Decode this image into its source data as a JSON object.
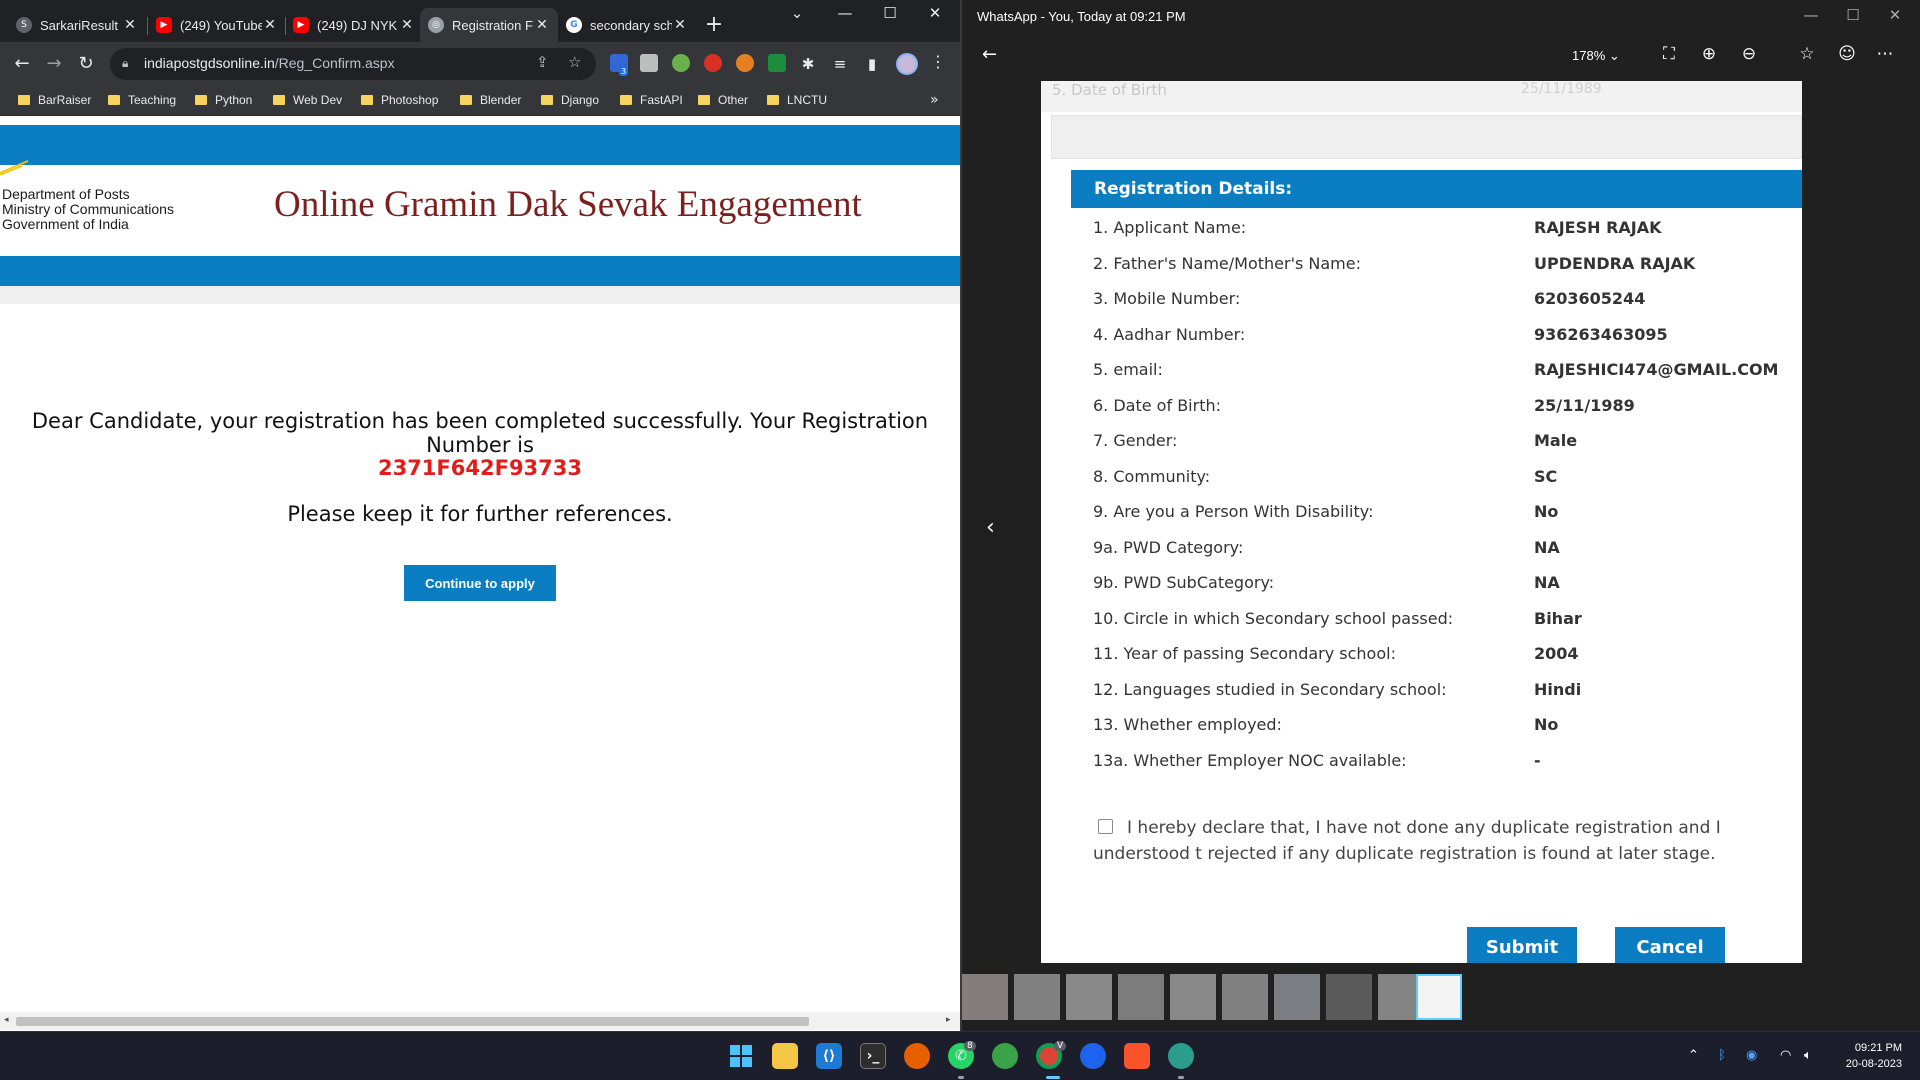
{
  "chrome": {
    "tabs": [
      {
        "title": "SarkariResult",
        "icon": "sarkari-favicon",
        "active": false
      },
      {
        "title": "(249) YouTube",
        "icon": "youtube-favicon",
        "active": false
      },
      {
        "title": "(249) DJ NYK",
        "icon": "youtube-favicon",
        "active": false
      },
      {
        "title": "Registration F",
        "icon": "globe-favicon",
        "active": true
      },
      {
        "title": "secondary sch",
        "icon": "google-favicon",
        "active": false
      }
    ],
    "url_domain": "indiapostgdsonline.in",
    "url_path": "/Reg_Confirm.aspx",
    "bookmarks": [
      "BarRaiser",
      "Teaching",
      "Python",
      "Web Dev",
      "Photoshop",
      "Blender",
      "Django",
      "FastAPI",
      "Other",
      "LNCTU"
    ],
    "ext_badge": "3"
  },
  "page": {
    "dept_lines": [
      "Department of Posts",
      "Ministry of Communications",
      "Government of India"
    ],
    "site_title": "Online Gramin Dak Sevak Engagement",
    "message": "Dear Candidate, your registration has been completed successfully. Your Registration Number is",
    "registration_number": "2371F642F93733",
    "keep_note": "Please keep it for further references.",
    "continue_label": "Continue to apply"
  },
  "viewer": {
    "title": "WhatsApp - You, Today at 09:21 PM",
    "zoom": "178%",
    "doc": {
      "top_cut_label": "5. Date of Birth",
      "top_cut_value": "25/11/1989",
      "section_title": "Registration Details:",
      "rows": [
        {
          "label": "1. Applicant Name:",
          "value": "RAJESH RAJAK"
        },
        {
          "label": "2. Father's Name/Mother's Name:",
          "value": "UPDENDRA RAJAK"
        },
        {
          "label": "3. Mobile Number:",
          "value": "6203605244"
        },
        {
          "label": "4. Aadhar Number:",
          "value": "936263463095"
        },
        {
          "label": "5. email:",
          "value": "RAJESHICI474@GMAIL.COM"
        },
        {
          "label": "6. Date of Birth:",
          "value": "25/11/1989"
        },
        {
          "label": "7. Gender:",
          "value": "Male"
        },
        {
          "label": "8. Community:",
          "value": "SC"
        },
        {
          "label": "9. Are you a Person With Disability:",
          "value": "No"
        },
        {
          "label": "9a. PWD Category:",
          "value": "NA"
        },
        {
          "label": "9b. PWD SubCategory:",
          "value": "NA"
        },
        {
          "label": "10. Circle in which Secondary school passed:",
          "value": "Bihar"
        },
        {
          "label": "11. Year of passing Secondary school:",
          "value": "2004"
        },
        {
          "label": "12. Languages studied in Secondary school:",
          "value": "Hindi"
        },
        {
          "label": "13. Whether employed:",
          "value": "No"
        },
        {
          "label": "13a. Whether Employer NOC available:",
          "value": "-"
        }
      ],
      "declaration": "I hereby declare that, I have not done any duplicate registration and I understood t rejected if any duplicate registration is found at later stage.",
      "submit_label": "Submit",
      "cancel_label": "Cancel"
    }
  },
  "taskbar": {
    "time": "09:21 PM",
    "date": "20-08-2023",
    "whatsapp_badge": "8",
    "chrome_badge": "V"
  },
  "colors": {
    "site_blue": "#0b7dc3",
    "site_title": "#7b1f1f",
    "reg_number": "#e41b1b"
  }
}
